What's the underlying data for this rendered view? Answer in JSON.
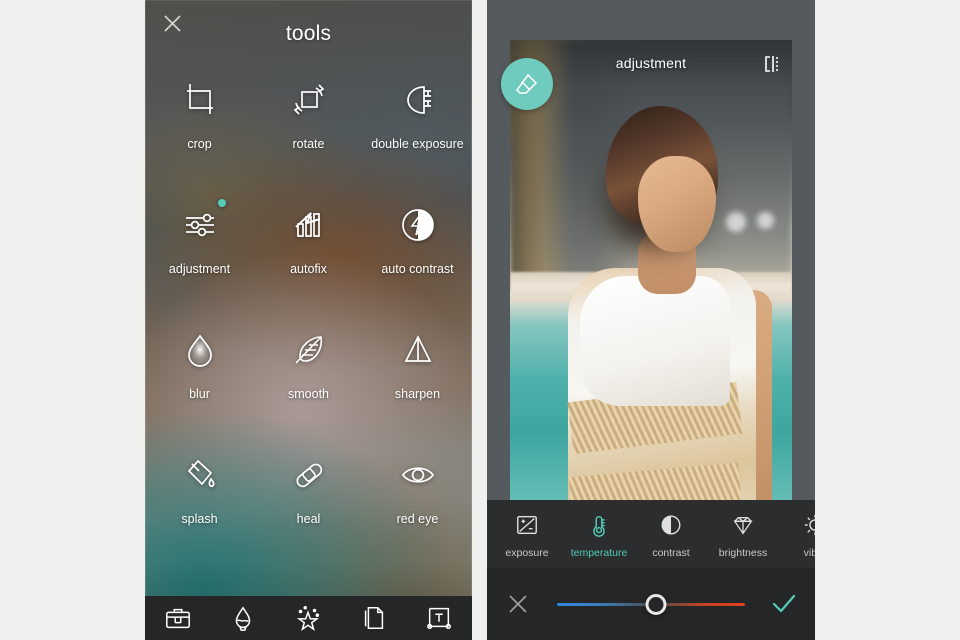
{
  "background_color": "#efefee",
  "accent_teal": "#54cdb9",
  "tools_panel": {
    "title": "tools",
    "close_icon": "close-x-icon",
    "tools": [
      {
        "label": "crop",
        "icon": "crop-icon",
        "badge": false
      },
      {
        "label": "rotate",
        "icon": "rotate-icon",
        "badge": false
      },
      {
        "label": "double exposure",
        "icon": "double-exposure-icon",
        "badge": false
      },
      {
        "label": "adjustment",
        "icon": "sliders-icon",
        "badge": true
      },
      {
        "label": "autofix",
        "icon": "autofix-icon",
        "badge": false
      },
      {
        "label": "auto contrast",
        "icon": "auto-contrast-icon",
        "badge": false
      },
      {
        "label": "blur",
        "icon": "blur-drop-icon",
        "badge": false
      },
      {
        "label": "smooth",
        "icon": "feather-icon",
        "badge": false
      },
      {
        "label": "sharpen",
        "icon": "sharpen-icon",
        "badge": false
      },
      {
        "label": "splash",
        "icon": "paint-bucket-icon",
        "badge": false
      },
      {
        "label": "heal",
        "icon": "bandage-icon",
        "badge": false
      },
      {
        "label": "red eye",
        "icon": "eye-icon",
        "badge": false
      }
    ],
    "bottom_bar": [
      {
        "name": "toolbox",
        "icon": "toolbox-icon"
      },
      {
        "name": "effects",
        "icon": "brush-drop-icon"
      },
      {
        "name": "magic",
        "icon": "magic-star-icon"
      },
      {
        "name": "layers",
        "icon": "paper-layers-icon"
      },
      {
        "name": "text",
        "icon": "text-box-icon"
      }
    ]
  },
  "editor_panel": {
    "photo_title": "adjustment",
    "compare_icon": "split-compare-icon",
    "eraser_icon": "eraser-icon",
    "adjustments": [
      {
        "label": "exposure",
        "icon": "exposure-icon",
        "active": false
      },
      {
        "label": "temperature",
        "icon": "thermometer-icon",
        "active": true
      },
      {
        "label": "contrast",
        "icon": "contrast-icon",
        "active": false
      },
      {
        "label": "brightness",
        "icon": "diamond-icon",
        "active": false
      },
      {
        "label": "vibra",
        "icon": "sun-icon",
        "active": false
      }
    ],
    "slider": {
      "cancel_icon": "close-x-icon",
      "confirm_icon": "check-icon",
      "knob_position_percent": 52.5,
      "gradient_from": "#2f86e0",
      "gradient_to": "#e0411c"
    }
  }
}
